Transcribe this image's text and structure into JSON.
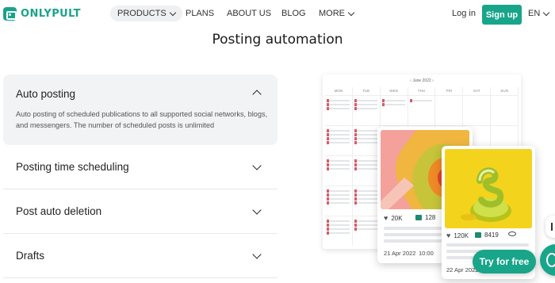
{
  "brand": {
    "name": "ONLYPULT",
    "color": "#1aa38a"
  },
  "nav": {
    "items": [
      {
        "label": "PRODUCTS",
        "has_dropdown": true,
        "active": true
      },
      {
        "label": "PLANS",
        "has_dropdown": false
      },
      {
        "label": "ABOUT US",
        "has_dropdown": false
      },
      {
        "label": "BLOG",
        "has_dropdown": false
      },
      {
        "label": "MORE",
        "has_dropdown": true
      }
    ],
    "login_label": "Log in",
    "signup_label": "Sign up",
    "language": "EN"
  },
  "section": {
    "title": "Posting automation"
  },
  "accordion": [
    {
      "title": "Auto posting",
      "expanded": true,
      "description": "Auto posting of scheduled publications to all supported social networks, blogs, and messengers. The number of scheduled posts is unlimited"
    },
    {
      "title": "Posting time scheduling",
      "expanded": false
    },
    {
      "title": "Post auto deletion",
      "expanded": false
    },
    {
      "title": "Drafts",
      "expanded": false
    }
  ],
  "calendar": {
    "month_label": "‹ June 2022 ›",
    "days": [
      "MON",
      "TUE",
      "WED",
      "THU",
      "FRI",
      "SAT",
      "SUN"
    ]
  },
  "post_cards": [
    {
      "likes": "20K",
      "comments": "128",
      "date": "21 Apr 2022",
      "time": "10:00",
      "image": "abstract-orange-art"
    },
    {
      "likes": "120K",
      "comments": "8419",
      "date": "22 Apr 2022",
      "image": "lime-on-yellow"
    }
  ],
  "cta": {
    "try_label": "Try for free"
  },
  "colors": {
    "accent": "#18a58a",
    "accordion_bg": "#f1f3f5"
  }
}
